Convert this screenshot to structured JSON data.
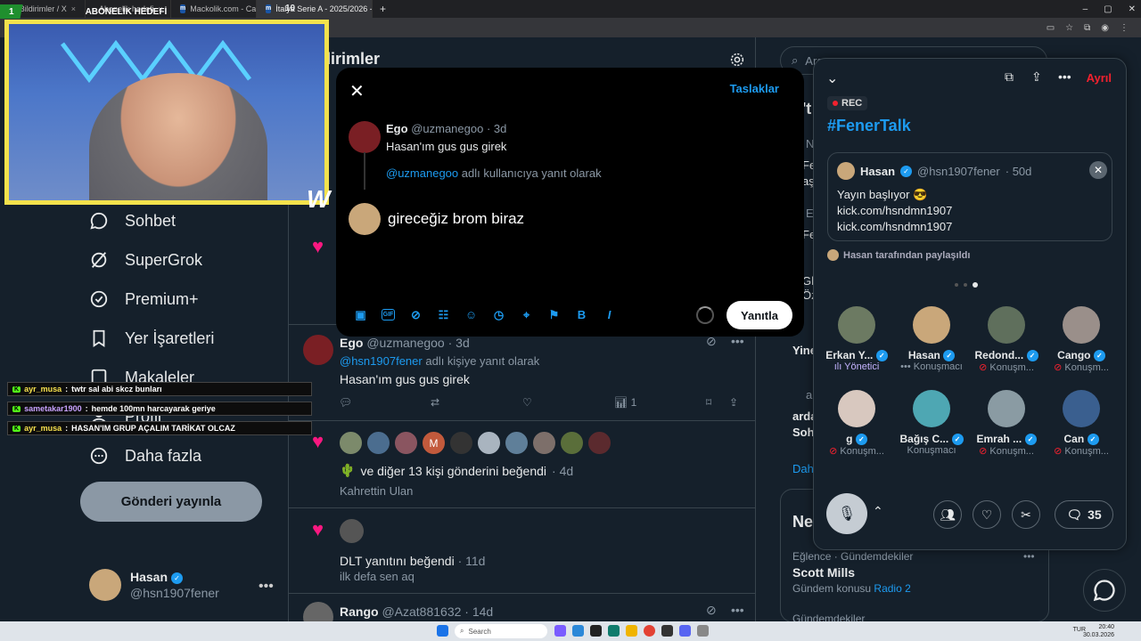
{
  "browser": {
    "tabs": [
      {
        "label": "Bildirimler / X",
        "active": false
      },
      {
        "label": "Abonelik hedefi",
        "active": false
      },
      {
        "label": "Mackolik.com - Canli mac",
        "active": false
      },
      {
        "label": "İtalya Serie A - 2025/2026 - Pu",
        "active": true
      }
    ],
    "new_tab": "+"
  },
  "stream_overlay": {
    "badge_number": "1",
    "title": "ABONELİK HEDEFİ",
    "counter": "10",
    "chat": [
      {
        "user": "ayr_musa",
        "message": "twtr sal abi skcz bunları",
        "style": "gold"
      },
      {
        "user": "sametakar1900",
        "message": "hemde 100mn harcayarak geriye",
        "style": "purple"
      },
      {
        "user": "ayr_musa",
        "message": "HASAN'IM GRUP AÇALIM TARİKAT OLCAZ",
        "style": "gold"
      }
    ]
  },
  "left_nav": {
    "items": [
      "Sohbet",
      "SuperGrok",
      "Premium+",
      "Yer İşaretleri",
      "Makaleler",
      "Profil",
      "Daha fazla"
    ],
    "post_button": "Gönderi yayınla",
    "account": {
      "name": "Hasan",
      "handle": "@hsn1907fener",
      "more": "•••"
    }
  },
  "timeline": {
    "title": "dirimler",
    "tweet": {
      "author": "Ego",
      "handle": "@uzmanegoo",
      "time": "· 3d",
      "reply_to_handle": "@hsn1907fener",
      "reply_to_suffix": "adlı kişiye yanıt olarak",
      "text": "Hasan'ım gus gus girek",
      "views": "1"
    },
    "like_notice": {
      "text": "ve diğer 13 kişi gönderini beğendi",
      "time": "· 4d",
      "sub": "Kahrettin Ulan",
      "liker_initial": "M"
    },
    "dlt": {
      "text": "DLT yanıtını beğendi",
      "time": "· 11d",
      "sub": "ilk defa sen aq"
    },
    "rango": {
      "author": "Rango",
      "handle": "@Azat881632",
      "time": "· 14d"
    }
  },
  "compose": {
    "drafts": "Taslaklar",
    "original": {
      "author": "Ego",
      "handle": "@uzmanegoo",
      "time": "· 3d",
      "text": "Hasan'ım gus gus girek"
    },
    "replying_handle": "@uzmanegoo",
    "replying_suffix": "adlı kullanıcıya yanıt olarak",
    "draft_text": "gireceğiz brom biraz",
    "reply_button": "Yanıtla"
  },
  "right_column": {
    "search_placeholder": "Ara",
    "peek": [
      "Ne",
      "'t",
      "N",
      "Fe",
      "aş",
      "E",
      "Fe",
      "Gl",
      "Öz",
      "Yine",
      "a",
      "arda",
      "Soh",
      "Dah"
    ],
    "news_title": "Ne",
    "trend": {
      "category": "Eğlence · Gündemdekiler",
      "name": "Scott Mills",
      "context_prefix": "Gündem konusu",
      "context_link": "Radio 2"
    },
    "trend2": "Gündemdekiler"
  },
  "space": {
    "leave": "Ayrıl",
    "rec": "REC",
    "title": "#FenerTalk",
    "pinned": {
      "author": "Hasan",
      "handle": "@hsn1907fener",
      "time": "· 50d",
      "line1": "Yayın başlıyor 😎",
      "line2": "kick.com/hsndmn1907",
      "line3": "kick.com/hsndmn1907"
    },
    "shared_by": "Hasan tarafından paylaşıldı",
    "speakers": [
      {
        "name": "Erkan Y...",
        "role": "Yönetici",
        "role_icon": "host"
      },
      {
        "name": "Hasan",
        "role": "Konuşmacı",
        "role_icon": "cohost"
      },
      {
        "name": "Redond...",
        "role": "Konuşm...",
        "role_icon": "muted"
      },
      {
        "name": "Cango",
        "role": "Konuşm...",
        "role_icon": "muted"
      },
      {
        "name": "g",
        "role": "Konuşm...",
        "role_icon": "muted"
      },
      {
        "name": "Bağış C...",
        "role": "Konuşmacı",
        "role_icon": "none"
      },
      {
        "name": "Emrah ...",
        "role": "Konuşm...",
        "role_icon": "muted"
      },
      {
        "name": "Can",
        "role": "Konuşm...",
        "role_icon": "muted"
      }
    ],
    "comment_count": "35"
  },
  "taskbar": {
    "search": "Search",
    "lang": "TUR",
    "time": "20:40",
    "date": "30.03.2026"
  },
  "colors": {
    "accent": "#1d9bf0",
    "like": "#f91880",
    "leave": "#f4212e",
    "overlay": "#f4e24c"
  }
}
